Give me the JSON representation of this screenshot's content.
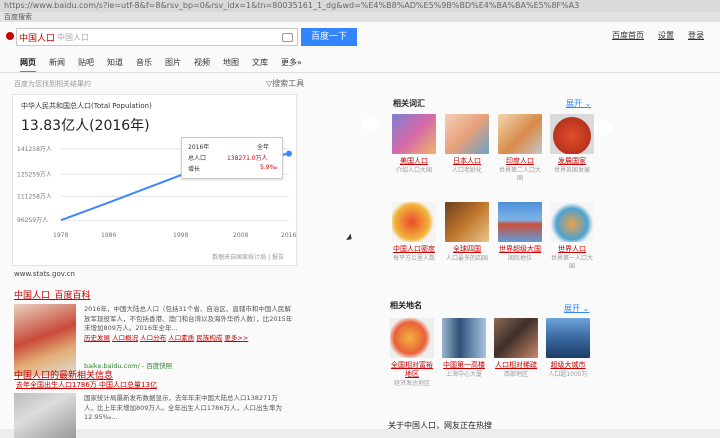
{
  "browser": {
    "url": "https://www.baidu.com/s?ie=utf-8&f=8&rsv_bp=0&rsv_idx=1&tn=80035161_1_dg&wd=%E4%B8%AD%E5%9B%BD%E4%BA%BA%E5%8F%A3",
    "tab": "百度搜索"
  },
  "search": {
    "query": "中国人口",
    "hint": "中国人口",
    "button": "百度一下"
  },
  "top_links": [
    "百度首页",
    "设置",
    "登录"
  ],
  "tabs": [
    "网页",
    "新闻",
    "贴吧",
    "知道",
    "音乐",
    "图片",
    "视频",
    "地图",
    "文库",
    "更多»"
  ],
  "result_meta": "百度为您找到相关结果约",
  "tools_label": "搜索工具",
  "card": {
    "title": "中华人民共和国总人口(Total Population)",
    "headline": "13.83亿人(2016年)",
    "tooltip": {
      "year": "2016年",
      "year_right": "全年",
      "row1_label": "总人口",
      "row1_value": "138271.0万人",
      "row2_label": "增长",
      "row2_value": "5.9‰"
    },
    "source": "数据来自国家统计局 | 报告",
    "site": "www.stats.gov.cn"
  },
  "chart_data": {
    "type": "line",
    "title": "中华人民共和国总人口(Total Population)",
    "x": [
      1978,
      1986,
      1998,
      2006,
      2016
    ],
    "values": [
      96259,
      107507,
      124761,
      131448,
      138271
    ],
    "yticks": [
      "141258万人",
      "125259万人",
      "111258万人",
      "96259万人"
    ],
    "ytick_values": [
      141258,
      125259,
      111258,
      96259
    ],
    "xticks": [
      "1978",
      "1986",
      "1998",
      "2008",
      "2016"
    ],
    "ylim": [
      92000,
      145000
    ],
    "xlim": [
      1978,
      2016
    ],
    "color": "#3a86ff"
  },
  "results": [
    {
      "title": "中国人口_百度百科",
      "text_hl": "中国人口",
      "text": "2016年，中国大陆总人口（包括31个省、自治区、直辖市和中国人民解放军现役军人，不包括香港、澳门和台湾以及海外华侨人数），比2015年末增加809万人。2016年全年...",
      "links": [
        "历史发展",
        "人口概况",
        "人口分布",
        "人口素质",
        "民族构成",
        "更多>>"
      ],
      "url": "baike.baidu.com/ - 百度快照"
    },
    {
      "title": "中国人口的最新相关信息",
      "sub": "去年全国出生人口1786万 中国人口总量13亿",
      "text": "国家统计局最新发布数据显示，去年年末中国大陆总人口138271万人，比上年末增加809万人。全年出生人口1786万人，人口出生率为12.95‰..."
    }
  ],
  "right": {
    "related_title": "相关词汇",
    "related_more": "展开",
    "related": [
      {
        "label": "美国人口",
        "sub": "介绍人口大国"
      },
      {
        "label": "日本人口",
        "sub": "人口老龄化"
      },
      {
        "label": "印度人口",
        "sub": "世界第二人口大国"
      },
      {
        "label": "发展国家",
        "sub": "世界各国发展"
      },
      {
        "label": "中国人口密度",
        "sub": "每平方公里人数"
      },
      {
        "label": "全球四国",
        "sub": "人口最多的四国"
      },
      {
        "label": "世界超级大国",
        "sub": "国际地位"
      },
      {
        "label": "世界人口",
        "sub": "世界第一人口大国"
      }
    ],
    "places_title": "相关地名",
    "places_more": "展开",
    "places": [
      {
        "label": "全国相对富裕地区",
        "sub": "经济发达地区"
      },
      {
        "label": "中国第一高楼",
        "sub": "上海中心大厦"
      },
      {
        "label": "人口相对稀疏",
        "sub": "西部地区"
      },
      {
        "label": "超级大城市",
        "sub": "人口超1000万"
      }
    ],
    "footer": "关于中国人口，网友正在热搜"
  }
}
